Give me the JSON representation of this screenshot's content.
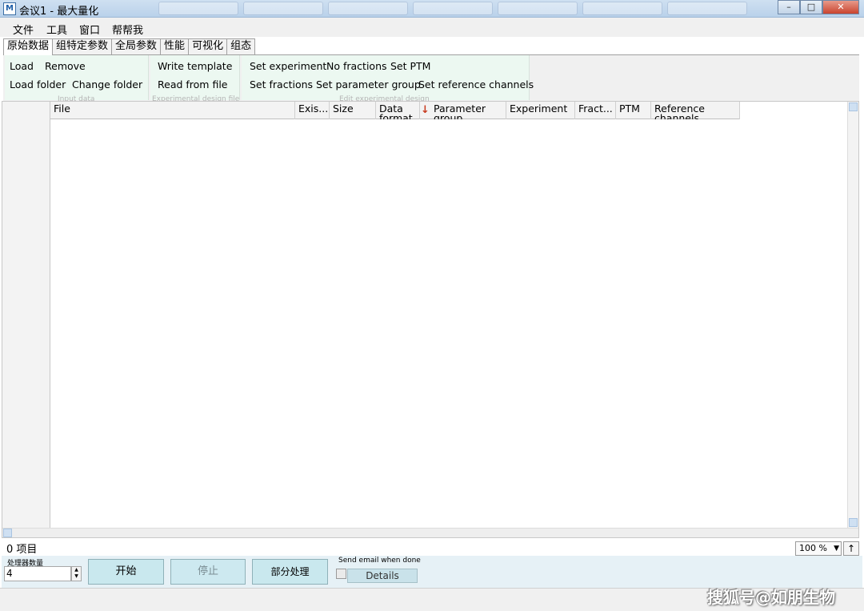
{
  "window": {
    "title": "会议1 - 最大量化",
    "controls": {
      "minimize": "–",
      "maximize": "□",
      "close": "✕"
    }
  },
  "menu": [
    "文件",
    "工具",
    "窗口",
    "帮帮我"
  ],
  "tabs": [
    "原始数据",
    "组特定参数",
    "全局参数",
    "性能",
    "可视化",
    "组态"
  ],
  "ribbon": {
    "input_data": {
      "label": "Input data",
      "buttons": [
        "Load",
        "Remove",
        "Load folder",
        "Change folder"
      ]
    },
    "design_file": {
      "label": "Experimental design file",
      "buttons": [
        "Write template",
        "Read from file"
      ]
    },
    "edit_design": {
      "label": "Edit experimental design",
      "buttons": [
        "Set experiment",
        "No fractions",
        "Set PTM",
        "Set fractions",
        "Set parameter group",
        "Set reference channels"
      ]
    }
  },
  "table": {
    "columns": [
      "File",
      "Exis...",
      "Size",
      "Data format",
      "Parameter group",
      "Experiment",
      "Fract...",
      "PTM",
      "Reference channels"
    ],
    "rows": []
  },
  "status": {
    "item_count": "0 项目",
    "zoom": "100 %"
  },
  "bottom": {
    "processor_label": "处理器数量",
    "processor_value": "4",
    "start": "开始",
    "stop": "停止",
    "partial": "部分处理",
    "email_label": "Send email when done",
    "details": "Details"
  },
  "watermark": "搜狐号@如朋生物"
}
